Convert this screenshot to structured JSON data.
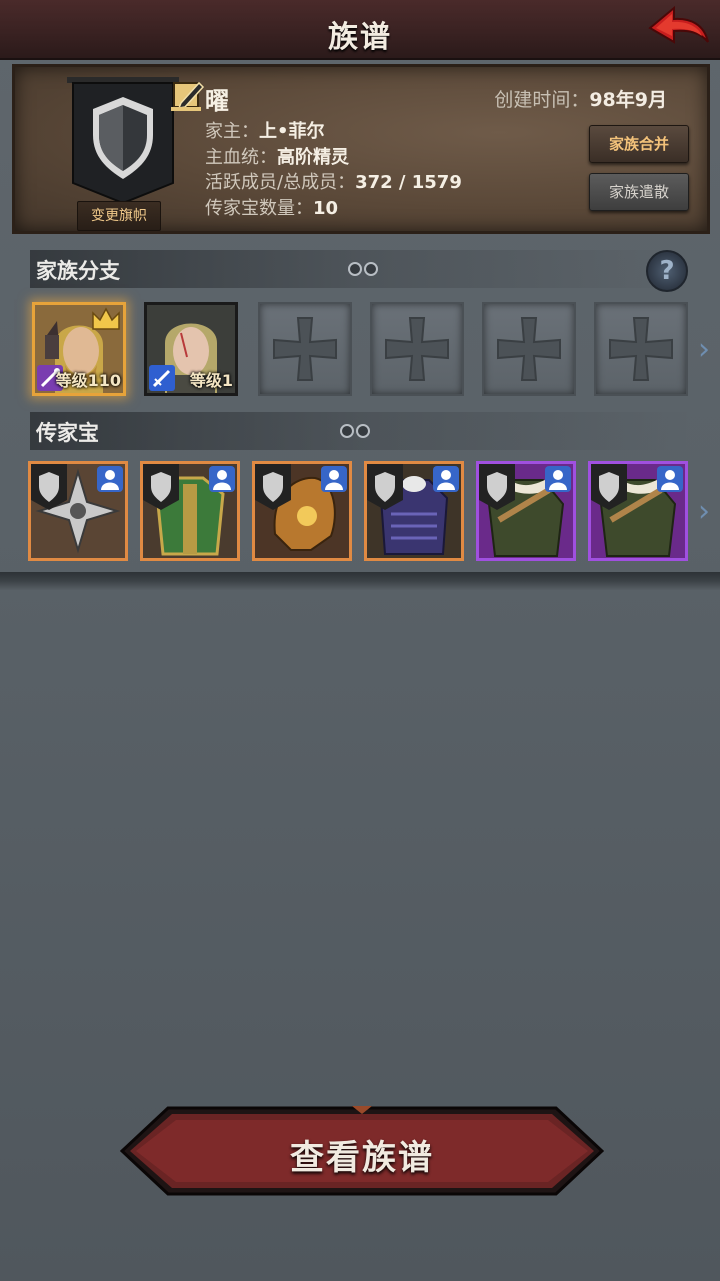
{
  "header": {
    "title": "族谱"
  },
  "family": {
    "name": "曜",
    "created_label": "创建时间：",
    "created_value": "98年9月",
    "change_flag_label": "变更旗帜",
    "head_label": "家主：",
    "head_value": "上•菲尔",
    "bloodline_label": "主血统：",
    "bloodline_value": "高阶精灵",
    "members_label": "活跃成员/总成员：",
    "members_value": "372 / 1579",
    "heirloom_count_label": "传家宝数量：",
    "heirloom_count_value": "10",
    "merge_label": "家族合并",
    "disband_label": "家族遣散"
  },
  "branches": {
    "title": "家族分支",
    "heroes": [
      {
        "level_text": "等级110",
        "weapon": "staff-icon",
        "leader": true
      },
      {
        "level_text": "等级1",
        "weapon": "sword-icon",
        "leader": false
      }
    ],
    "empty_slots": 4
  },
  "heirlooms": {
    "title": "传家宝",
    "items": [
      {
        "name": "shuriken",
        "rarity": "orange"
      },
      {
        "name": "green-armor",
        "rarity": "orange"
      },
      {
        "name": "golden-helm",
        "rarity": "orange"
      },
      {
        "name": "purple-armor",
        "rarity": "orange"
      },
      {
        "name": "fur-cloak",
        "rarity": "purple"
      },
      {
        "name": "fur-cloak",
        "rarity": "purple"
      }
    ]
  },
  "colors": {
    "orange_border": "#e08a43",
    "purple_border": "#a050e0",
    "accent_gold": "#f3c27a"
  },
  "footer": {
    "view_tree_label": "查看族谱"
  }
}
